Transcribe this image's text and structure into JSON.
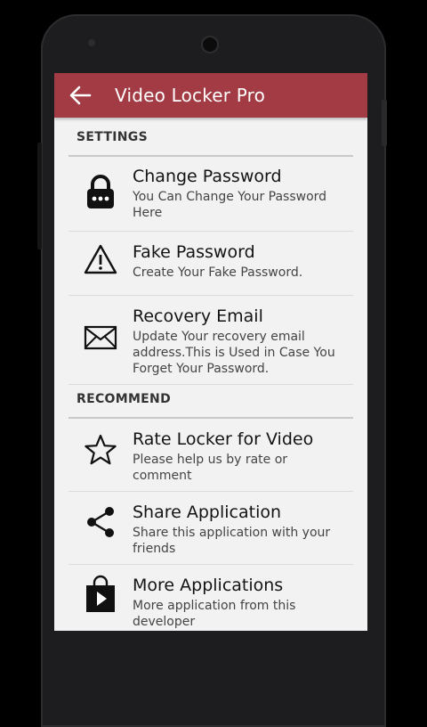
{
  "app": {
    "title": "Video Locker Pro",
    "accent_color": "#a23b44"
  },
  "sections": [
    {
      "header": "SETTINGS",
      "items": [
        {
          "title": "Change Password",
          "subtitle": "You Can Change Your Password Here",
          "icon": "lock-icon"
        },
        {
          "title": "Fake Password",
          "subtitle": "Create Your Fake Password.",
          "icon": "warning-icon"
        },
        {
          "title": "Recovery Email",
          "subtitle": "Update Your recovery email address.This is Used in Case You Forget Your Password.",
          "icon": "mail-icon"
        }
      ]
    },
    {
      "header": "RECOMMEND",
      "items": [
        {
          "title": "Rate Locker for Video",
          "subtitle": "Please help us by rate or comment",
          "icon": "star-icon"
        },
        {
          "title": "Share Application",
          "subtitle": "Share this application with your friends",
          "icon": "share-icon"
        },
        {
          "title": "More Applications",
          "subtitle": "More application from this developer",
          "icon": "play-store-icon"
        }
      ]
    }
  ]
}
